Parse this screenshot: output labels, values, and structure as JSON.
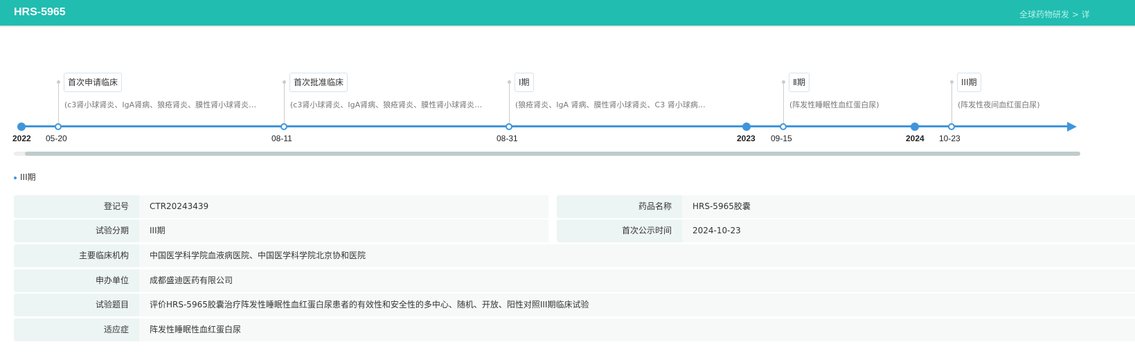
{
  "header": {
    "title": "HRS-5965",
    "breadcrumb": "全球药物研发 > 详"
  },
  "timeline": {
    "years": [
      {
        "label": "2022"
      },
      {
        "label": "2023"
      },
      {
        "label": "2024"
      }
    ],
    "events": [
      {
        "date": "05-20",
        "label": "首次申请临床",
        "desc": "(c3肾小球肾炎、IgA肾病、狼疮肾炎、膜性肾小球肾炎…"
      },
      {
        "date": "08-11",
        "label": "首次批准临床",
        "desc": "(c3肾小球肾炎、IgA肾病、狼疮肾炎、膜性肾小球肾炎…"
      },
      {
        "date": "08-31",
        "label": "Ⅰ期",
        "desc": "(狼疮肾炎、IgA 肾病、膜性肾小球肾炎、C3 肾小球病…"
      },
      {
        "date": "09-15",
        "label": "Ⅱ期",
        "desc": "(阵发性睡眠性血红蛋白尿)"
      },
      {
        "date": "10-23",
        "label": "III期",
        "desc": "(阵发性夜间血红蛋白尿)"
      }
    ],
    "accent": "#3f95db"
  },
  "section": {
    "title": "III期"
  },
  "details": {
    "reg_no": {
      "label": "登记号",
      "value": "CTR20243439"
    },
    "drug_name": {
      "label": "药品名称",
      "value": "HRS-5965胶囊"
    },
    "phase": {
      "label": "试验分期",
      "value": "III期"
    },
    "first_pub": {
      "label": "首次公示时间",
      "value": "2024-10-23"
    },
    "institution": {
      "label": "主要临床机构",
      "value": "中国医学科学院血液病医院、中国医学科学院北京协和医院"
    },
    "sponsor": {
      "label": "申办单位",
      "value": "成都盛迪医药有限公司"
    },
    "trial_title": {
      "label": "试验题目",
      "value": "评价HRS-5965胶囊治疗阵发性睡眠性血红蛋白尿患者的有效性和安全性的多中心、随机、开放、阳性对照III期临床试验"
    },
    "indication": {
      "label": "适应症",
      "value": "阵发性睡眠性血红蛋白尿"
    }
  },
  "colors": {
    "header": "#20bdb0"
  }
}
